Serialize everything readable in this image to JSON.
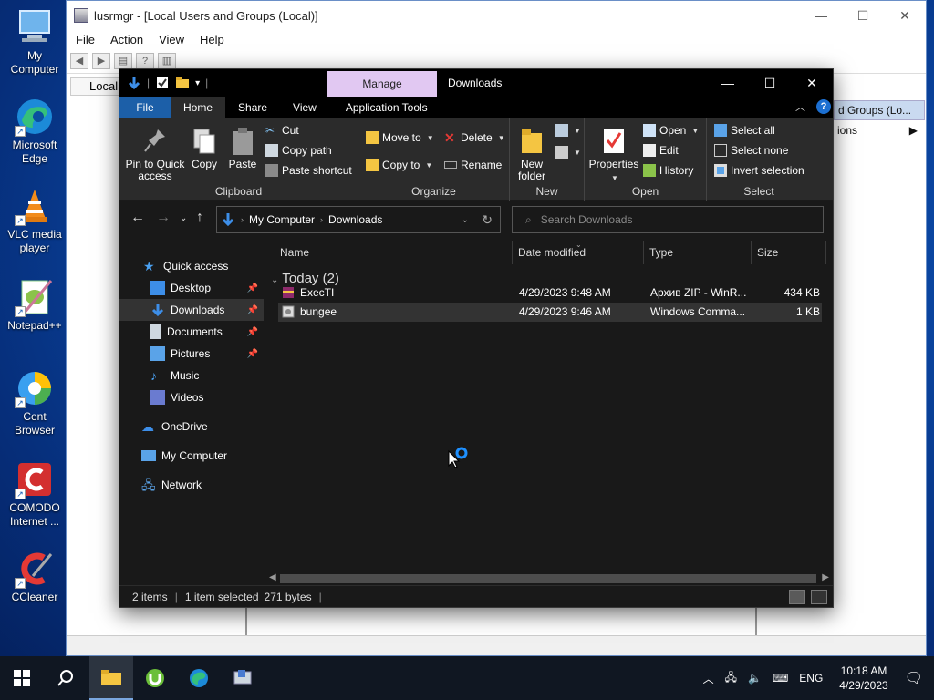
{
  "desktop": {
    "icons": [
      {
        "label": "My Computer"
      },
      {
        "label": "Microsoft Edge"
      },
      {
        "label": "VLC media player"
      },
      {
        "label": "Notepad++"
      },
      {
        "label": "Cent Browser"
      },
      {
        "label": "COMODO Internet ..."
      },
      {
        "label": "CCleaner"
      }
    ]
  },
  "lusrmgr": {
    "title": "lusrmgr - [Local Users and Groups (Local)]",
    "menu": [
      "File",
      "Action",
      "View",
      "Help"
    ],
    "tree_item": "Local",
    "actions_header": "d Groups (Lo...",
    "actions_row": "ions"
  },
  "explorer": {
    "title": "Downloads",
    "manage_tab": "Manage",
    "tabs": [
      "File",
      "Home",
      "Share",
      "View",
      "Application Tools"
    ],
    "ribbon": {
      "clipboard": {
        "name": "Clipboard",
        "pin": "Pin to Quick access",
        "copy": "Copy",
        "paste": "Paste",
        "cut": "Cut",
        "copy_path": "Copy path",
        "paste_shortcut": "Paste shortcut"
      },
      "organize": {
        "name": "Organize",
        "move_to": "Move to",
        "copy_to": "Copy to",
        "delete": "Delete",
        "rename": "Rename"
      },
      "new": {
        "name": "New",
        "new_folder": "New folder"
      },
      "open": {
        "name": "Open",
        "properties": "Properties",
        "open": "Open",
        "edit": "Edit",
        "history": "History"
      },
      "select": {
        "name": "Select",
        "select_all": "Select all",
        "select_none": "Select none",
        "invert": "Invert selection"
      }
    },
    "address": {
      "crumbs": [
        "My Computer",
        "Downloads"
      ]
    },
    "search": {
      "placeholder": "Search Downloads"
    },
    "nav": {
      "quick_access": "Quick access",
      "items": [
        "Desktop",
        "Downloads",
        "Documents",
        "Pictures",
        "Music",
        "Videos"
      ],
      "onedrive": "OneDrive",
      "my_computer": "My Computer",
      "network": "Network"
    },
    "columns": {
      "name": "Name",
      "date": "Date modified",
      "type": "Type",
      "size": "Size"
    },
    "group": "Today (2)",
    "files": [
      {
        "name": "ExecTI",
        "date": "4/29/2023 9:48 AM",
        "type": "Архив ZIP - WinR...",
        "size": "434 KB"
      },
      {
        "name": "bungee",
        "date": "4/29/2023 9:46 AM",
        "type": "Windows Comma...",
        "size": "1 KB"
      }
    ],
    "status": {
      "items": "2 items",
      "selected": "1 item selected",
      "size": "271 bytes",
      "sep": "|"
    }
  },
  "taskbar": {
    "lang": "ENG",
    "time": "10:18 AM",
    "date": "4/29/2023"
  }
}
